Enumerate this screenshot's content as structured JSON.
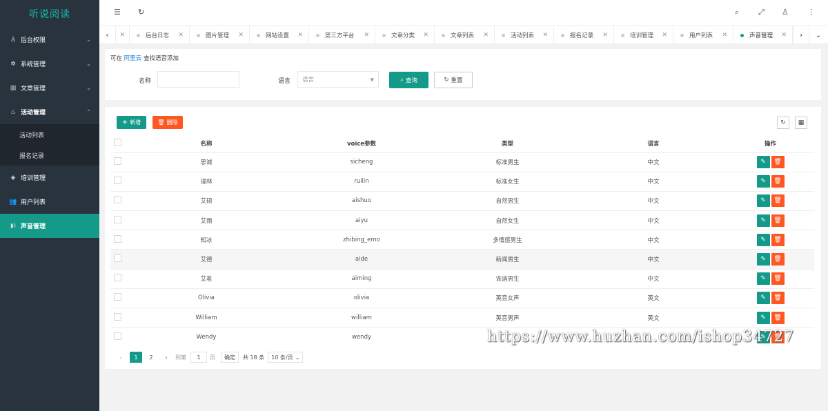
{
  "app": {
    "title": "听说阅读"
  },
  "sidebar": {
    "items": [
      {
        "label": "后台权限",
        "icon": "user-icon",
        "chevron": "⌄"
      },
      {
        "label": "系统管理",
        "icon": "gear-icon",
        "chevron": "⌄"
      },
      {
        "label": "文章管理",
        "icon": "book-icon",
        "chevron": "⌄"
      },
      {
        "label": "活动管理",
        "icon": "fire-icon",
        "chevron": "⌃"
      },
      {
        "label": "培训管理",
        "icon": "diamond-icon"
      },
      {
        "label": "用户列表",
        "icon": "users-icon"
      },
      {
        "label": "声音管理",
        "icon": "sound-icon"
      }
    ],
    "subitems": [
      {
        "label": "活动列表"
      },
      {
        "label": "报名记录"
      }
    ]
  },
  "tabs": [
    {
      "label": "后台日志"
    },
    {
      "label": "图片管理"
    },
    {
      "label": "网站设置"
    },
    {
      "label": "第三方平台"
    },
    {
      "label": "文章分类"
    },
    {
      "label": "文章列表"
    },
    {
      "label": "活动列表"
    },
    {
      "label": "报名记录"
    },
    {
      "label": "培训管理"
    },
    {
      "label": "用户列表"
    },
    {
      "label": "声音管理"
    }
  ],
  "search": {
    "tip_prefix": "可在",
    "tip_link": "阿里云",
    "tip_suffix": "查找语音添加",
    "name_label": "名称",
    "name_value": "",
    "lang_label": "语言",
    "lang_placeholder": "语言",
    "query_label": "查询",
    "reset_label": "重置"
  },
  "toolbar": {
    "add_label": "新增",
    "delete_label": "删除"
  },
  "table": {
    "columns": [
      "名称",
      "voice参数",
      "类型",
      "语言",
      "操作"
    ],
    "rows": [
      {
        "name": "思诚",
        "voice": "sicheng",
        "type": "标准男生",
        "lang": "中文"
      },
      {
        "name": "瑞林",
        "voice": "ruilin",
        "type": "标准女生",
        "lang": "中文"
      },
      {
        "name": "艾硕",
        "voice": "aishuo",
        "type": "自然男生",
        "lang": "中文"
      },
      {
        "name": "艾雨",
        "voice": "aiyu",
        "type": "自然女生",
        "lang": "中文"
      },
      {
        "name": "知冰",
        "voice": "zhibing_emo",
        "type": "多情感男生",
        "lang": "中文"
      },
      {
        "name": "艾德",
        "voice": "aide",
        "type": "新闻男生",
        "lang": "中文"
      },
      {
        "name": "艾茗",
        "voice": "aiming",
        "type": "诙谐男生",
        "lang": "中文"
      },
      {
        "name": "Olivia",
        "voice": "olivia",
        "type": "英音女声",
        "lang": "英文"
      },
      {
        "name": "William",
        "voice": "william",
        "type": "英音男声",
        "lang": "英文"
      },
      {
        "name": "Wendy",
        "voice": "wendy",
        "type": "",
        "lang": ""
      }
    ]
  },
  "pagination": {
    "pages": [
      "1",
      "2"
    ],
    "goto_label": "到第",
    "goto_value": "1",
    "page_unit": "页",
    "confirm_label": "确定",
    "total_label": "共 18 条",
    "page_size": "10 条/页"
  },
  "watermark": "https://www.huzhan.com/ishop34727",
  "colors": {
    "accent": "#139a88",
    "danger": "#ff5722",
    "sidebar": "#28333e"
  }
}
